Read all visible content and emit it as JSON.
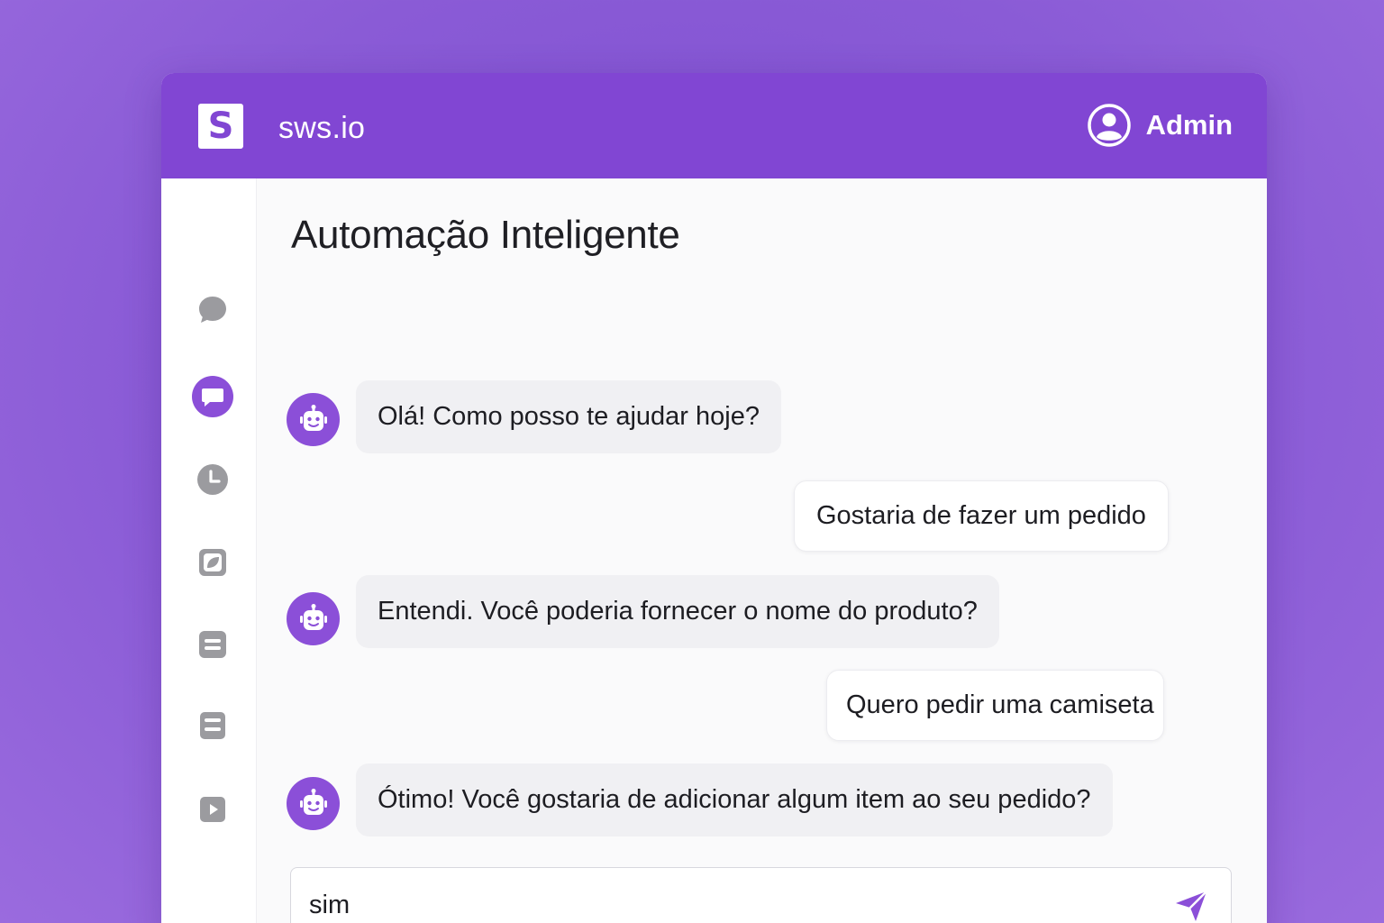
{
  "app": {
    "logo_letter": "S",
    "brand": "sws.io",
    "user_name": "Admin",
    "accent_color": "#8146d3"
  },
  "sidebar": {
    "items": [
      {
        "icon": "chat-bubble-icon",
        "active": false
      },
      {
        "icon": "message-square-icon",
        "active": true
      },
      {
        "icon": "clock-icon",
        "active": false
      },
      {
        "icon": "leaf-icon",
        "active": false
      },
      {
        "icon": "list-icon",
        "active": false
      },
      {
        "icon": "document-icon",
        "active": false
      },
      {
        "icon": "play-icon",
        "active": false
      }
    ]
  },
  "main": {
    "title": "Automação Inteligente",
    "messages": [
      {
        "from": "bot",
        "text": "Olá! Como posso te ajudar hoje?"
      },
      {
        "from": "user",
        "text": "Gostaria de fazer um pedido"
      },
      {
        "from": "bot",
        "text": "Entendi. Você poderia fornecer o nome do produto?"
      },
      {
        "from": "user",
        "text": "Quero pedir uma camiseta"
      },
      {
        "from": "bot",
        "text": "Ótimo! Você gostaria de adicionar algum item ao seu pedido?"
      }
    ]
  },
  "composer": {
    "value": "sim",
    "placeholder": ""
  }
}
